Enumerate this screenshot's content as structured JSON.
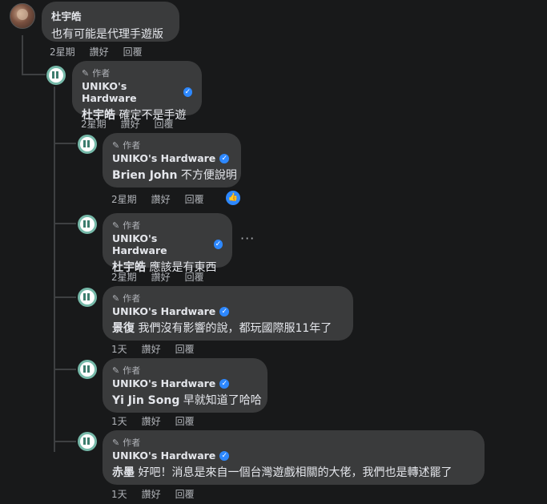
{
  "top_comment": {
    "author": "杜宇皓",
    "text": "也有可能是代理手遊版",
    "time": "2星期",
    "like": "讚好",
    "reply": "回覆"
  },
  "replies": [
    {
      "tag": "作者",
      "author": "UNIKO's Hardware",
      "mention": "杜宇皓",
      "text": " 確定不是手遊",
      "time": "2星期",
      "like": "讚好",
      "reply": "回覆"
    },
    {
      "tag": "作者",
      "author": "UNIKO's Hardware",
      "mention": "Brien John",
      "text": " 不方便說明",
      "time": "2星期",
      "like": "讚好",
      "reply": "回覆"
    },
    {
      "tag": "作者",
      "author": "UNIKO's Hardware",
      "mention": "杜宇皓",
      "text": " 應該是有東西",
      "time": "2星期",
      "like": "讚好",
      "reply": "回覆"
    },
    {
      "tag": "作者",
      "author": "UNIKO's Hardware",
      "mention": "景復",
      "text": " 我們沒有影響的說，都玩國際服11年了",
      "time": "1天",
      "like": "讚好",
      "reply": "回覆"
    },
    {
      "tag": "作者",
      "author": "UNIKO's Hardware",
      "mention": "Yi Jin Song",
      "text": " 早就知道了哈哈",
      "time": "1天",
      "like": "讚好",
      "reply": "回覆"
    },
    {
      "tag": "作者",
      "author": "UNIKO's Hardware",
      "mention": "赤墨",
      "text": " 好吧！消息是來自一個台灣遊戲相關的大佬，我們也是轉述罷了",
      "time": "1天",
      "like": "讚好",
      "reply": "回覆"
    }
  ],
  "icons": {
    "pencil": "pencil-icon",
    "verified": "verified-badge-icon",
    "like": "like-reaction-icon",
    "more": "more-options-icon"
  },
  "colors": {
    "background": "#18191a",
    "bubble": "#3a3b3c",
    "accent": "#2d88ff",
    "secondary_text": "#b0b3b8"
  }
}
